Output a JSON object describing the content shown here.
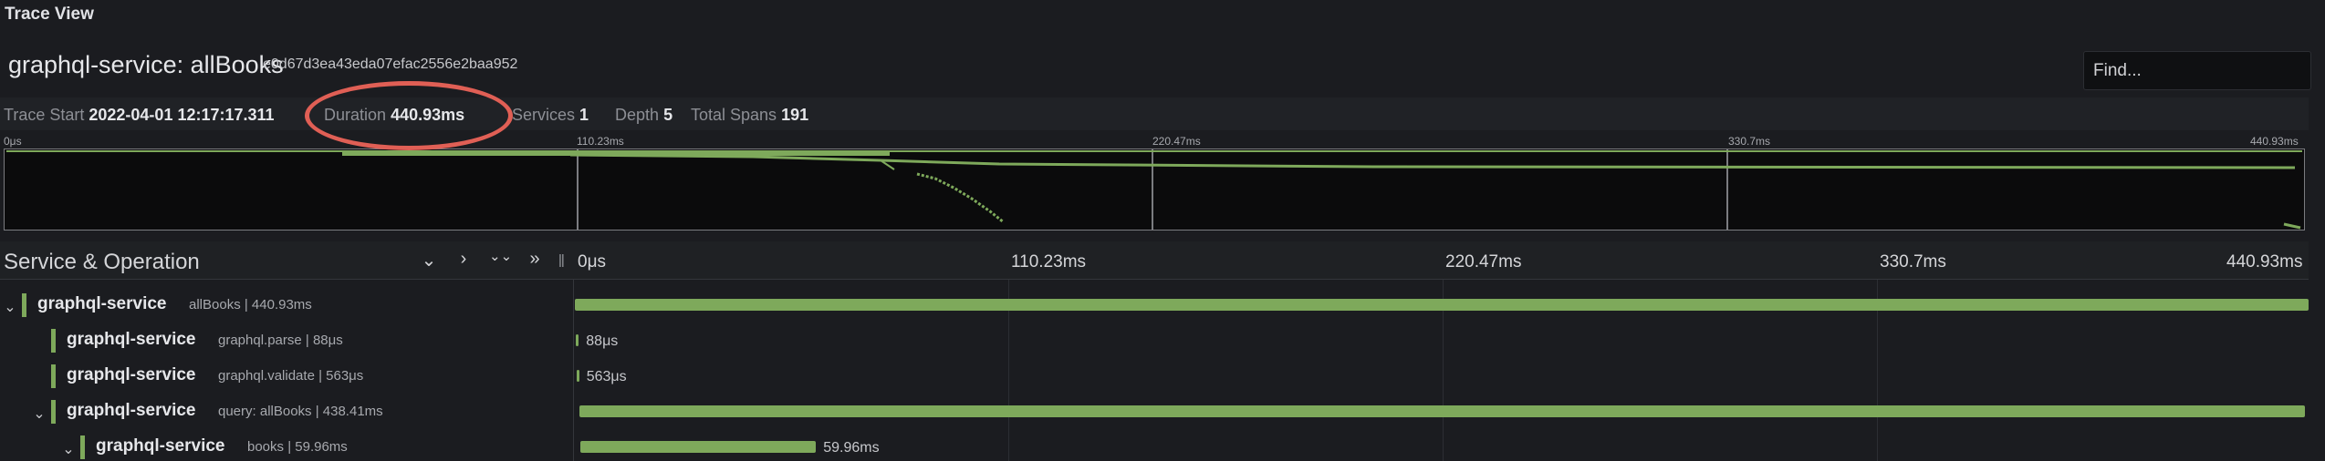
{
  "panel": {
    "title": "Trace View"
  },
  "trace": {
    "name": "graphql-service: allBooks",
    "id": "e0d67d3ea43eda07efac2556e2baa952",
    "find_placeholder": "Find..."
  },
  "meta": {
    "trace_start_label": "Trace Start",
    "trace_start_value": "2022-04-01 12:17:17.311",
    "duration_label": "Duration",
    "duration_value": "440.93ms",
    "services_label": "Services",
    "services_value": "1",
    "depth_label": "Depth",
    "depth_value": "5",
    "total_spans_label": "Total Spans",
    "total_spans_value": "191"
  },
  "minimap": {
    "ticks": [
      "0μs",
      "110.23ms",
      "220.47ms",
      "330.7ms",
      "440.93ms"
    ]
  },
  "timeline_header": {
    "title": "Service & Operation",
    "ticks": [
      "0μs",
      "110.23ms",
      "220.47ms",
      "330.7ms",
      "440.93ms"
    ],
    "controls": {
      "collapse_one": "⌄",
      "expand_one": "›",
      "collapse_all": "⌄⌄",
      "expand_all": "»"
    }
  },
  "total_duration_ms": 440.93,
  "spans": [
    {
      "depth": 0,
      "expanded": true,
      "has_children": true,
      "service": "graphql-service",
      "operation": "allBooks | 440.93ms",
      "start_ms": 0,
      "duration_ms": 440.93,
      "bar_label": ""
    },
    {
      "depth": 1,
      "expanded": false,
      "has_children": false,
      "service": "graphql-service",
      "operation": "graphql.parse | 88μs",
      "start_ms": 0.3,
      "duration_ms": 0.088,
      "bar_label": "88μs"
    },
    {
      "depth": 1,
      "expanded": false,
      "has_children": false,
      "service": "graphql-service",
      "operation": "graphql.validate | 563μs",
      "start_ms": 0.4,
      "duration_ms": 0.563,
      "bar_label": "563μs"
    },
    {
      "depth": 1,
      "expanded": true,
      "has_children": true,
      "service": "graphql-service",
      "operation": "query: allBooks | 438.41ms",
      "start_ms": 1.1,
      "duration_ms": 438.41,
      "bar_label": ""
    },
    {
      "depth": 2,
      "expanded": true,
      "has_children": true,
      "service": "graphql-service",
      "operation": "books | 59.96ms",
      "start_ms": 1.3,
      "duration_ms": 59.96,
      "bar_label": "59.96ms"
    }
  ],
  "colors": {
    "span": "#7ea95b",
    "highlight": "#e05f55",
    "background": "#1b1c20"
  }
}
